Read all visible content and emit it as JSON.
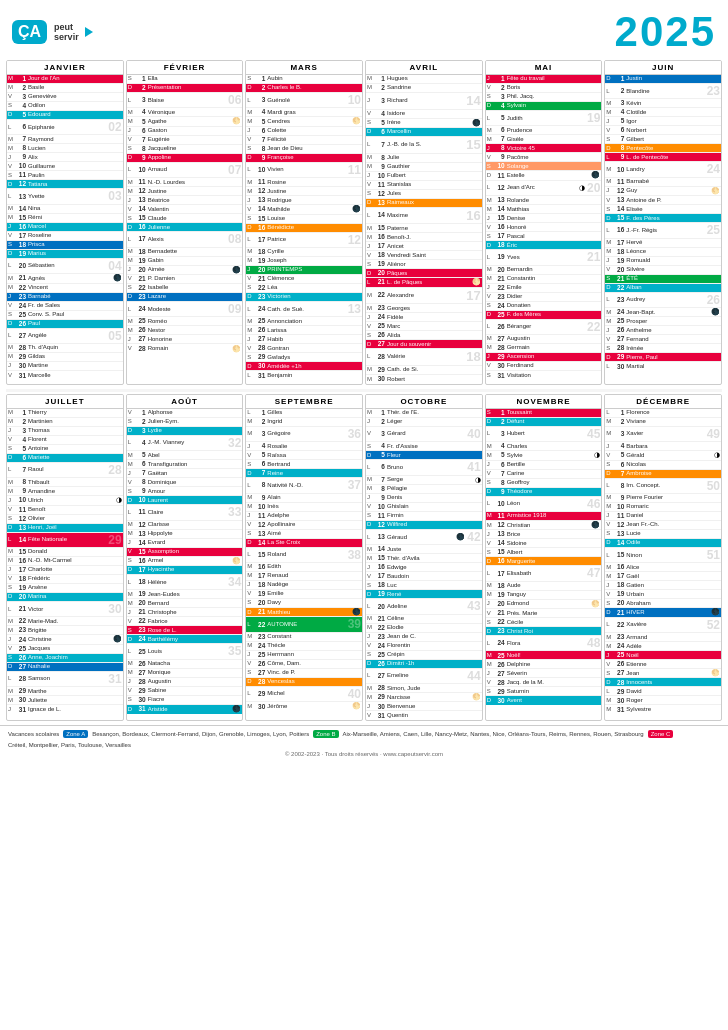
{
  "header": {
    "logo_ca": "ÇA",
    "logo_peut": "peut",
    "logo_servir": "servir",
    "year": "2025"
  },
  "months": {
    "janvier": "JANVIER",
    "fevrier": "FÉVRIER",
    "mars": "MARS",
    "avril": "AVRIL",
    "mai": "MAI",
    "juin": "JUIN",
    "juillet": "JUILLET",
    "aout": "AOÛT",
    "septembre": "SEPTEMBRE",
    "octobre": "OCTOBRE",
    "novembre": "NOVEMBRE",
    "decembre": "DÉCEMBRE"
  },
  "footer": {
    "vacances_label": "Vacances scolaires",
    "zone_a_label": "Zone A",
    "zone_a_cities": "Besançon, Bordeaux, Clermont-Ferrand, Dijon, Grenoble, Limoges, Lyon, Poitiers",
    "zone_b_label": "Zone B",
    "zone_b_cities": "Aix-Marseille, Amiens, Caen, Lille, Nancy-Metz, Nantes, Nice, Orléans-Tours, Reims, Rennes, Rouen, Strasbourg",
    "zone_c_label": "Zone C",
    "zone_c_cities": "Créteil, Montpellier, Paris, Toulouse, Versailles",
    "copyright": "© 2002-2023 · Tous droits réservés · www.capeutservir.com"
  }
}
